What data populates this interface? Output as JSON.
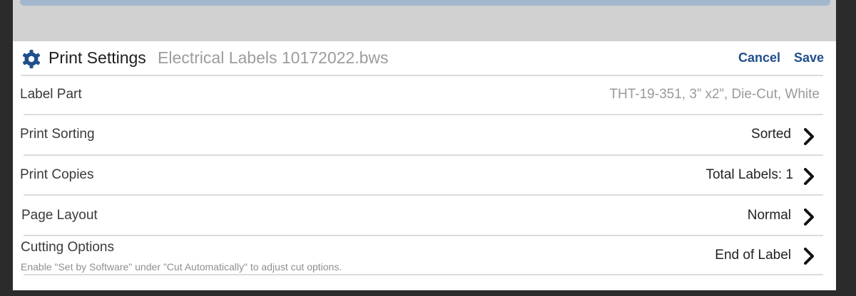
{
  "header": {
    "title": "Print Settings",
    "filename": "Electrical Labels 10172022.bws",
    "cancel_label": "Cancel",
    "save_label": "Save",
    "icon": "gear-icon"
  },
  "rows": [
    {
      "label": "Label Part",
      "value": "THT-19-351, 3” x2”, Die-Cut, White",
      "has_chevron": false
    },
    {
      "label": "Print Sorting",
      "value": "Sorted",
      "has_chevron": true
    },
    {
      "label": "Print Copies",
      "value": "Total Labels: 1",
      "has_chevron": true
    },
    {
      "label": "Page Layout",
      "value": "Normal",
      "has_chevron": true
    },
    {
      "label": "Cutting Options",
      "value": "End of Label",
      "has_chevron": true,
      "note": "Enable \"Set by Software\" under \"Cut Automatically\" to adjust cut options."
    }
  ],
  "colors": {
    "accent": "#1f4e8c",
    "top_bar": "#a3b7cd",
    "backdrop": "#d1d1d1",
    "frame": "#2b2b2b"
  }
}
